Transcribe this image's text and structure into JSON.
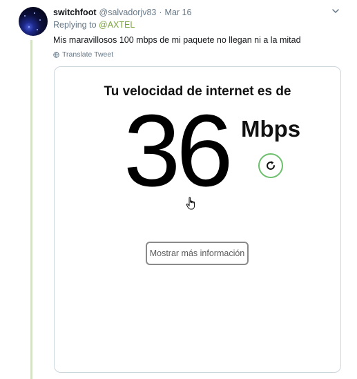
{
  "tweet": {
    "display_name": "switchfoot",
    "handle": "@salvadorjv83",
    "separator": "·",
    "date": "Mar 16",
    "replying_prefix": "Replying to",
    "replying_to": "@AXTEL",
    "text": "Mis maravillosos 100 mbps de mi paquete no llegan ni a la mitad",
    "translate_label": "Translate Tweet"
  },
  "card": {
    "title": "Tu velocidad de internet es de",
    "speed": "36",
    "unit": "Mbps",
    "more_button": "Mostrar más información"
  },
  "colors": {
    "thread_line": "#d4e3c6",
    "mention": "#7aa33d",
    "refresh_ring": "#6cc06c"
  },
  "icons": [
    "chevron-down-icon",
    "globe-icon",
    "refresh-icon",
    "hand-cursor-icon"
  ]
}
